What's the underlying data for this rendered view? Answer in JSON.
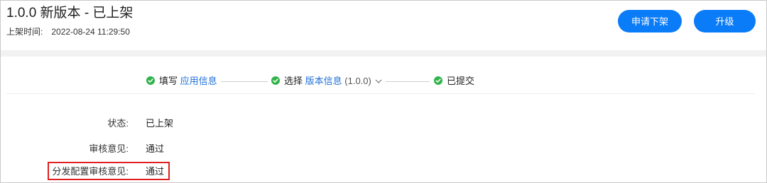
{
  "header": {
    "title": "1.0.0 新版本 - 已上架",
    "listed_time_label": "上架时间:",
    "listed_time_value": "2022-08-24 11:29:50",
    "unlist_button": "申请下架",
    "upgrade_button": "升级"
  },
  "steps": [
    {
      "prefix": "填写",
      "link": "应用信息",
      "status": "done"
    },
    {
      "prefix": "选择",
      "link": "版本信息",
      "version": "(1.0.0)",
      "status": "done",
      "has_dropdown": true
    },
    {
      "prefix": "已提交",
      "status": "done"
    }
  ],
  "details": {
    "status_label": "状态:",
    "status_value": "已上架",
    "review_label": "审核意见:",
    "review_value": "通过",
    "dist_review_label": "分发配置审核意见:",
    "dist_review_value": "通过"
  },
  "colors": {
    "primary": "#0a7cf7",
    "link": "#1e6fd9",
    "success": "#2fb34a",
    "highlight": "#e02020"
  },
  "icons": {
    "step_done": "check-circle-icon",
    "dropdown": "chevron-down-icon"
  }
}
